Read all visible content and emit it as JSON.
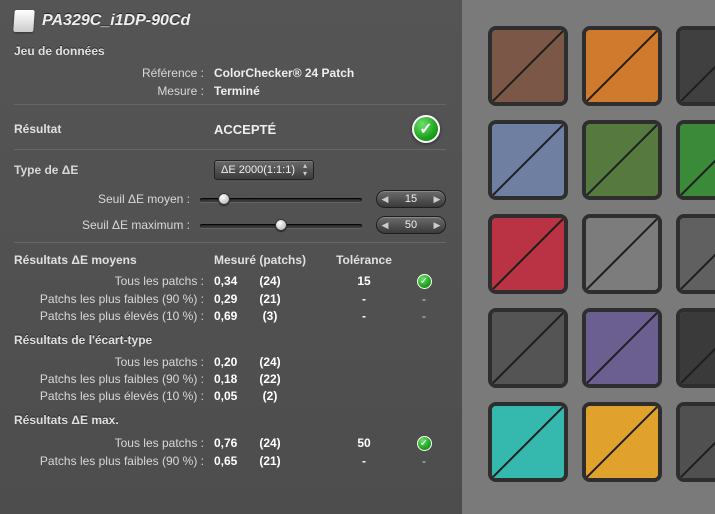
{
  "title": "PA329C_i1DP-90Cd",
  "dataset": {
    "heading": "Jeu de données",
    "ref_label": "Référence :",
    "ref_value": "ColorChecker® 24 Patch",
    "mes_label": "Mesure :",
    "mes_value": "Terminé"
  },
  "result": {
    "label": "Résultat",
    "status": "ACCEPTÉ"
  },
  "deltaE": {
    "type_label": "Type de ΔE",
    "type_value": "ΔE 2000(1:1:1)",
    "avg_label": "Seuil ΔE moyen :",
    "avg_value": "15",
    "avg_pos_pct": 15,
    "max_label": "Seuil ΔE maximum :",
    "max_value": "50",
    "max_pos_pct": 50
  },
  "headers": {
    "measured": "Mesuré (patchs)",
    "tolerance": "Tolérance"
  },
  "sections": {
    "means": "Résultats ΔE moyens",
    "stdev": "Résultats de l'écart-type",
    "max": "Résultats ΔE max."
  },
  "rows": {
    "means": [
      {
        "label": "Tous les patchs :",
        "val": "0,34",
        "count": "(24)",
        "tol": "15",
        "ok": true
      },
      {
        "label": "Patchs les plus faibles (90 %) :",
        "val": "0,29",
        "count": "(21)",
        "tol": "-",
        "ok": null
      },
      {
        "label": "Patchs les plus élevés (10 %) :",
        "val": "0,69",
        "count": "(3)",
        "tol": "-",
        "ok": null
      }
    ],
    "stdev": [
      {
        "label": "Tous les patchs :",
        "val": "0,20",
        "count": "(24)",
        "tol": "",
        "ok": null
      },
      {
        "label": "Patchs les plus faibles (90 %) :",
        "val": "0,18",
        "count": "(22)",
        "tol": "",
        "ok": null
      },
      {
        "label": "Patchs les plus élevés (10 %) :",
        "val": "0,05",
        "count": "(2)",
        "tol": "",
        "ok": null
      }
    ],
    "max": [
      {
        "label": "Tous les patchs :",
        "val": "0,76",
        "count": "(24)",
        "tol": "50",
        "ok": true
      },
      {
        "label": "Patchs les plus faibles (90 %) :",
        "val": "0,65",
        "count": "(21)",
        "tol": "-",
        "ok": null
      }
    ]
  },
  "swatches": [
    {
      "a": "#7a5746",
      "b": "#7a5746"
    },
    {
      "a": "#d07a2e",
      "b": "#d07a2e"
    },
    {
      "a": "#404040",
      "b": "#404040"
    },
    {
      "a": "#6f7fa2",
      "b": "#6f7fa2"
    },
    {
      "a": "#56793f",
      "b": "#56793f"
    },
    {
      "a": "#3a8a3a",
      "b": "#3a8a3a"
    },
    {
      "a": "#b93344",
      "b": "#b93344"
    },
    {
      "a": "#7c7c7c",
      "b": "#7c7c7c"
    },
    {
      "a": "#606060",
      "b": "#606060"
    },
    {
      "a": "#545454",
      "b": "#545454"
    },
    {
      "a": "#6a5f90",
      "b": "#6a5f90"
    },
    {
      "a": "#3a3a3a",
      "b": "#3a3a3a"
    },
    {
      "a": "#35b8ae",
      "b": "#35b8ae"
    },
    {
      "a": "#e0a22d",
      "b": "#e0a22d"
    },
    {
      "a": "#505050",
      "b": "#505050"
    }
  ]
}
